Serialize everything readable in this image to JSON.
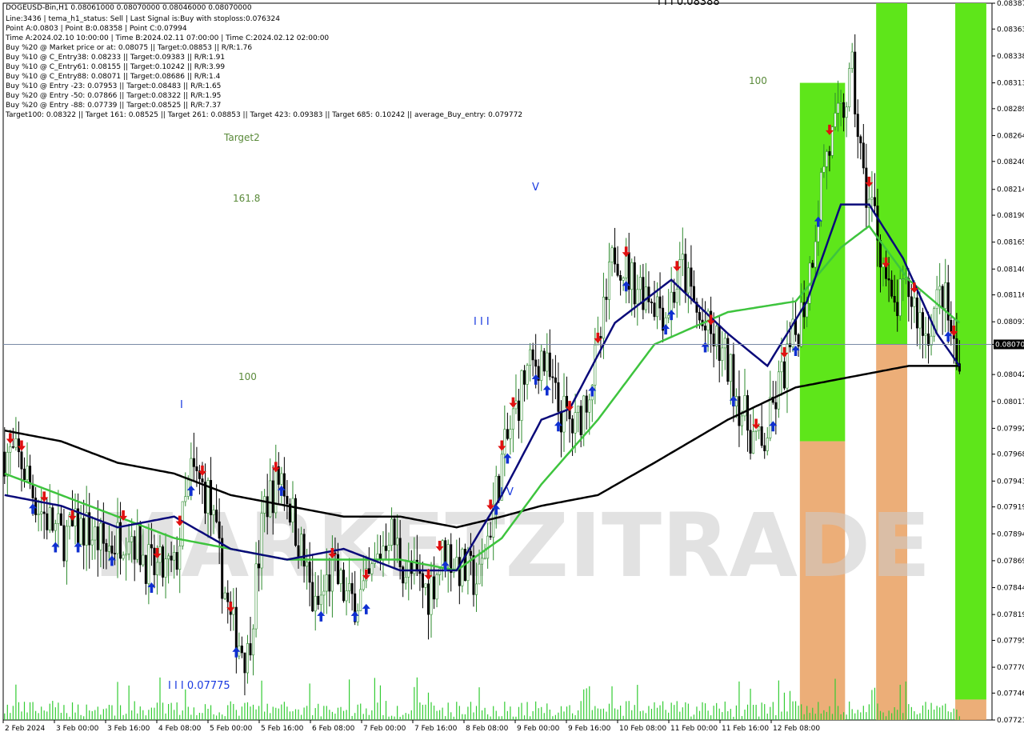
{
  "header": {
    "lines": [
      "DOGEUSD-Bin,H1  0.08061000 0.08070000 0.08046000 0.08070000",
      "Line:3436 | tema_h1_status: Sell | Last Signal is:Buy with stoploss:0.076324",
      "Point A:0.0803 | Point B:0.08358 | Point C:0.07994",
      "Time A:2024.02.10 10:00:00 | Time B:2024.02.11 07:00:00 | Time C:2024.02.12 02:00:00",
      "Buy %20 @ Market price or at: 0.08075 || Target:0.08853 || R/R:1.76",
      "Buy %10 @ C_Entry38: 0.08233 || Target:0.09383 || R/R:1.91",
      "Buy %10 @ C_Entry61: 0.08155 || Target:0.10242 || R/R:3.99",
      "Buy %10 @ C_Entry88: 0.08071 || Target:0.08686 || R/R:1.4",
      "Buy %10 @ Entry -23: 0.07953 || Target:0.08483 || R/R:1.65",
      "Buy %20 @ Entry -50: 0.07866 || Target:0.08322 || R/R:1.95",
      "Buy %20 @ Entry -88: 0.07739 || Target:0.08525 || R/R:7.37",
      "Target100: 0.08322 || Target 161: 0.08525 || Target 261: 0.08853 || Target 423: 0.09383 || Target 685: 0.10242 || average_Buy_entry: 0.079772"
    ]
  },
  "labels": {
    "target2": "Target2",
    "fib161": "161.8",
    "fib100_left": "100",
    "fib100_right": "100",
    "wave_top": "I I I 0.08388",
    "wave_bottom": "I I I 0.07775",
    "wave_iii": "I I I",
    "wave_v": "V",
    "wave_i": "I",
    "wave_iv": "I V"
  },
  "watermark": {
    "text": "MARKETZITRADE"
  },
  "colors": {
    "ema_blue": "#0a0a7a",
    "ema_green": "#3ec43e",
    "sma_black": "#000000",
    "bull_candle": "#2e8b2e",
    "bear_candle": "#000000",
    "arrow_up": "#1030d0",
    "arrow_down": "#e01010",
    "zone_green": "#5ee61a",
    "zone_orange": "#e9a060",
    "volume": "#33cc33",
    "price_line": "#7a8aa6"
  },
  "chart_data": {
    "type": "candlestick",
    "symbol": "DOGEUSD-Bin",
    "timeframe": "H1",
    "ylim": [
      0.07721,
      0.08387
    ],
    "current_price": "0.08070",
    "y_ticks": [
      "0.08387",
      "0.08363",
      "0.08338",
      "0.08313",
      "0.08289",
      "0.08264",
      "0.08240",
      "0.08214",
      "0.08190",
      "0.08165",
      "0.08140",
      "0.08116",
      "0.08091",
      "0.08070",
      "0.08042",
      "0.08017",
      "0.07992",
      "0.07968",
      "0.07943",
      "0.07919",
      "0.07894",
      "0.07869",
      "0.07844",
      "0.07819",
      "0.07795",
      "0.07770",
      "0.07746",
      "0.07721"
    ],
    "x_ticks": [
      "2 Feb 2024",
      "3 Feb 00:00",
      "3 Feb 16:00",
      "4 Feb 08:00",
      "5 Feb 00:00",
      "5 Feb 16:00",
      "6 Feb 08:00",
      "7 Feb 00:00",
      "7 Feb 16:00",
      "8 Feb 08:00",
      "9 Feb 00:00",
      "9 Feb 16:00",
      "10 Feb 08:00",
      "11 Feb 00:00",
      "11 Feb 16:00",
      "12 Feb 08:00"
    ],
    "close_path": [
      [
        0,
        0.0797
      ],
      [
        6,
        0.0796
      ],
      [
        12,
        0.0792
      ],
      [
        20,
        0.0789
      ],
      [
        28,
        0.079
      ],
      [
        36,
        0.0788
      ],
      [
        44,
        0.079
      ],
      [
        52,
        0.0786
      ],
      [
        60,
        0.0786
      ],
      [
        66,
        0.0795
      ],
      [
        72,
        0.0793
      ],
      [
        80,
        0.0781
      ],
      [
        86,
        0.0778
      ],
      [
        92,
        0.0792
      ],
      [
        98,
        0.0795
      ],
      [
        104,
        0.0789
      ],
      [
        110,
        0.0782
      ],
      [
        116,
        0.0786
      ],
      [
        122,
        0.0783
      ],
      [
        128,
        0.0784
      ],
      [
        136,
        0.079
      ],
      [
        142,
        0.0786
      ],
      [
        150,
        0.0784
      ],
      [
        156,
        0.0788
      ],
      [
        162,
        0.0786
      ],
      [
        168,
        0.0785
      ],
      [
        176,
        0.0796
      ],
      [
        184,
        0.0804
      ],
      [
        190,
        0.0806
      ],
      [
        196,
        0.0801
      ],
      [
        202,
        0.0799
      ],
      [
        210,
        0.0806
      ],
      [
        216,
        0.0816
      ],
      [
        222,
        0.0813
      ],
      [
        228,
        0.0812
      ],
      [
        234,
        0.081
      ],
      [
        240,
        0.0814
      ],
      [
        246,
        0.0809
      ],
      [
        252,
        0.0807
      ],
      [
        256,
        0.0805
      ],
      [
        262,
        0.08
      ],
      [
        268,
        0.0797
      ],
      [
        274,
        0.0803
      ],
      [
        280,
        0.0808
      ],
      [
        284,
        0.0812
      ],
      [
        290,
        0.0824
      ],
      [
        296,
        0.0828
      ],
      [
        300,
        0.0832
      ],
      [
        304,
        0.0822
      ],
      [
        308,
        0.0819
      ],
      [
        314,
        0.081
      ],
      [
        320,
        0.0812
      ],
      [
        326,
        0.0808
      ],
      [
        332,
        0.0812
      ],
      [
        338,
        0.0804
      ]
    ],
    "ema_fast": [
      [
        0,
        0.0793
      ],
      [
        20,
        0.0792
      ],
      [
        40,
        0.079
      ],
      [
        60,
        0.0791
      ],
      [
        80,
        0.0788
      ],
      [
        100,
        0.0787
      ],
      [
        120,
        0.0788
      ],
      [
        140,
        0.0786
      ],
      [
        160,
        0.0786
      ],
      [
        176,
        0.0793
      ],
      [
        190,
        0.08
      ],
      [
        200,
        0.0801
      ],
      [
        216,
        0.0809
      ],
      [
        236,
        0.0813
      ],
      [
        256,
        0.0808
      ],
      [
        270,
        0.0805
      ],
      [
        284,
        0.0811
      ],
      [
        296,
        0.082
      ],
      [
        306,
        0.082
      ],
      [
        318,
        0.0815
      ],
      [
        330,
        0.0808
      ],
      [
        338,
        0.0805
      ]
    ],
    "ema_slow": [
      [
        0,
        0.0795
      ],
      [
        20,
        0.0793
      ],
      [
        40,
        0.0791
      ],
      [
        60,
        0.0789
      ],
      [
        80,
        0.0788
      ],
      [
        100,
        0.0787
      ],
      [
        120,
        0.0787
      ],
      [
        140,
        0.0787
      ],
      [
        160,
        0.0786
      ],
      [
        176,
        0.0789
      ],
      [
        190,
        0.0794
      ],
      [
        210,
        0.08
      ],
      [
        230,
        0.0807
      ],
      [
        256,
        0.081
      ],
      [
        280,
        0.0811
      ],
      [
        296,
        0.0816
      ],
      [
        306,
        0.0818
      ],
      [
        320,
        0.0813
      ],
      [
        338,
        0.0809
      ]
    ],
    "sma_long": [
      [
        0,
        0.0799
      ],
      [
        20,
        0.0798
      ],
      [
        40,
        0.0796
      ],
      [
        60,
        0.0795
      ],
      [
        80,
        0.0793
      ],
      [
        100,
        0.0792
      ],
      [
        120,
        0.0791
      ],
      [
        140,
        0.0791
      ],
      [
        160,
        0.079
      ],
      [
        176,
        0.0791
      ],
      [
        190,
        0.0792
      ],
      [
        210,
        0.0793
      ],
      [
        230,
        0.0796
      ],
      [
        256,
        0.08
      ],
      [
        280,
        0.0803
      ],
      [
        300,
        0.0804
      ],
      [
        320,
        0.0805
      ],
      [
        338,
        0.0805
      ]
    ],
    "zones": [
      {
        "x0": 282,
        "x1": 298,
        "green_top": 0.08313,
        "split": 0.0798,
        "orange_bottom": 0.07721
      },
      {
        "x0": 309,
        "x1": 320,
        "green_top": 0.08387,
        "split": 0.0807,
        "orange_bottom": 0.07721
      },
      {
        "x0": 337,
        "x1": 348,
        "green_top": 0.08387,
        "split": 0.0774,
        "orange_bottom": 0.07721
      }
    ]
  },
  "footer_note": ""
}
